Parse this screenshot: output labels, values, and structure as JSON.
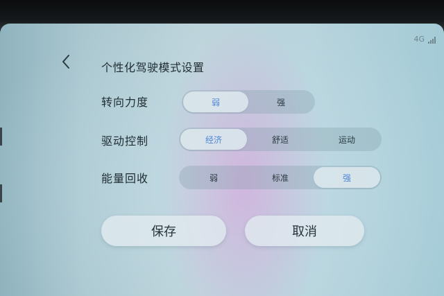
{
  "status": {
    "network": "4G"
  },
  "header": {
    "back_icon": "chevron-left-icon",
    "title": "个性化驾驶模式设置"
  },
  "settings": [
    {
      "label": "转向力度",
      "options": [
        "弱",
        "强"
      ],
      "selected": 0
    },
    {
      "label": "驱动控制",
      "options": [
        "经济",
        "舒适",
        "运动"
      ],
      "selected": 0
    },
    {
      "label": "能量回收",
      "options": [
        "弱",
        "标准",
        "强"
      ],
      "selected": 2
    }
  ],
  "actions": {
    "save_label": "保存",
    "cancel_label": "取消"
  },
  "colors": {
    "selected_text": "#4f86d6",
    "text": "#1f2d33"
  }
}
